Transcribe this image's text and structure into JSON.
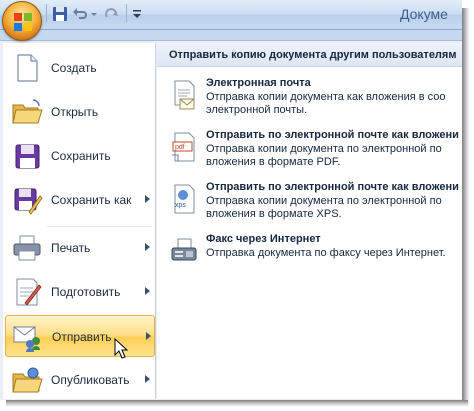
{
  "window": {
    "title": "Докуме"
  },
  "quick_access": {
    "icons": [
      "save-icon",
      "undo-icon",
      "dropdown-icon",
      "redo-icon",
      "customize-icon"
    ]
  },
  "menu": {
    "items": [
      {
        "label": "Создать",
        "icon": "new-document-icon",
        "has_submenu": false
      },
      {
        "label": "Открыть",
        "icon": "open-folder-icon",
        "has_submenu": false
      },
      {
        "label": "Сохранить",
        "icon": "save-disk-icon",
        "has_submenu": false
      },
      {
        "label": "Сохранить как",
        "icon": "save-as-icon",
        "has_submenu": true
      },
      {
        "label": "Печать",
        "icon": "printer-icon",
        "has_submenu": true
      },
      {
        "label": "Подготовить",
        "icon": "prepare-icon",
        "has_submenu": true
      },
      {
        "label": "Отправить",
        "icon": "send-icon",
        "has_submenu": true,
        "active": true
      },
      {
        "label": "Опубликовать",
        "icon": "publish-icon",
        "has_submenu": true
      }
    ]
  },
  "submenu": {
    "header": "Отправить копию документа другим пользователям",
    "options": [
      {
        "title": "Электронная почта",
        "desc": "Отправка копии документа как вложения в соо\nэлектронной почты.",
        "icon": "email-icon"
      },
      {
        "title": "Отправить по электронной почте как вложени",
        "desc": "Отправка копии документа по электронной по\nвложения в формате PDF.",
        "icon": "pdf-icon"
      },
      {
        "title": "Отправить по электронной почте как вложени",
        "desc": "Отправка копии документа по электронной по\nвложения в формате XPS.",
        "icon": "xps-icon"
      },
      {
        "title": "Факс через Интернет",
        "desc": "Отправка документа по факсу через Интернет.",
        "icon": "fax-icon"
      }
    ]
  },
  "colors": {
    "active_highlight": "#ffd86a",
    "menu_background": "#e9eef7",
    "office_button": "#f3a33a"
  }
}
